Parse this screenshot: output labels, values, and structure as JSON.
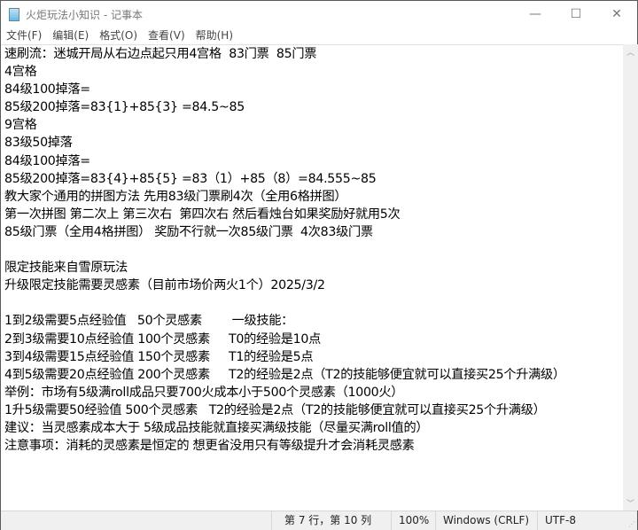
{
  "window": {
    "title": "火炬玩法小知识 - 记事本",
    "minimize": "—",
    "maximize": "☐",
    "close": "✕"
  },
  "menu": [
    "文件(F)",
    "编辑(E)",
    "格式(O)",
    "查看(V)",
    "帮助(H)"
  ],
  "lines": [
    "速刷流：迷城开局从右边点起只用4宫格  83门票  85门票",
    "4宫格",
    "84级100掉落=",
    "85级200掉落=83{1}+85{3} =84.5~85",
    "9宫格",
    "83级50掉落",
    "84级100掉落=",
    "85级200掉落=83{4}+85{5} =83（1）+85（8）=84.555~85",
    "教大家个通用的拼图方法 先用83级门票刷4次（全用6格拼图）",
    "第一次拼图 第二次上 第三次右  第四次右 然后看烛台如果奖励好就用5次",
    "85级门票（全用4格拼图） 奖励不行就一次85级门票  4次83级门票",
    "",
    "限定技能来自雪原玩法",
    "升级限定技能需要灵感素（目前市场价两火1个）2025/3/2",
    "",
    "1到2级需要5点经验值   50个灵感素        一级技能：",
    "2到3级需要10点经验值 100个灵感素     T0的经验是10点",
    "3到4级需要15点经验值 150个灵感素     T1的经验是5点",
    "4到5级需要20点经验值 200个灵感素     T2的经验是2点（T2的技能够便宜就可以直接买25个升满级）",
    "举例：市场有5级满roll成品只要700火成本小于500个灵感素（1000火）",
    "1升5级需要50经验值 500个灵感素   T2的经验是2点（T2的技能够便宜就可以直接买25个升满级）",
    "建议：当灵感素成本大于 5级成品技能就直接买满级技能（尽量买满roll值的）",
    "注意事项：消耗的灵感素是恒定的 想更省没用只有等级提升才会消耗灵感素"
  ],
  "status": {
    "position": "第 7 行，第 10 列",
    "zoom": "100%",
    "line_ending": "Windows (CRLF)",
    "encoding": "UTF-8"
  }
}
